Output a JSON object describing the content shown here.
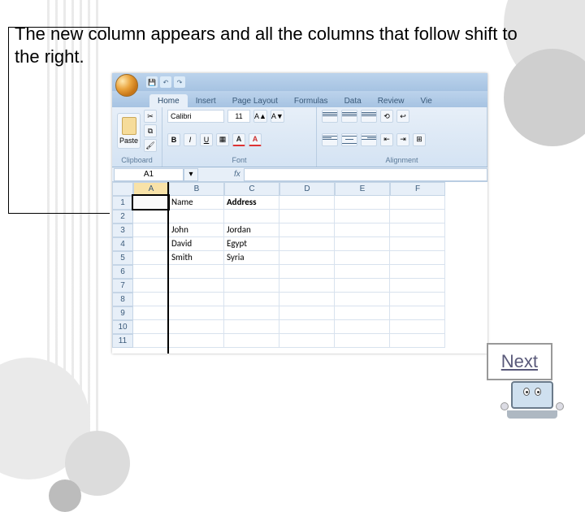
{
  "instruction": "The new column appears and all the columns that follow shift to the right.",
  "next_label": "Next",
  "excel": {
    "tabs": [
      "Home",
      "Insert",
      "Page Layout",
      "Formulas",
      "Data",
      "Review",
      "Vie"
    ],
    "active_tab_index": 0,
    "ribbon_groups": {
      "clipboard": {
        "paste_label": "Paste",
        "group_label": "Clipboard"
      },
      "font": {
        "font_name": "Calibri",
        "font_size": "11",
        "group_label": "Font",
        "bold": "B",
        "italic": "I",
        "underline": "U"
      },
      "alignment": {
        "group_label": "Alignment"
      }
    },
    "name_box": "A1",
    "fx_label": "fx",
    "formula_value": "",
    "columns": [
      "A",
      "B",
      "C",
      "D",
      "E",
      "F"
    ],
    "selected_column": "A",
    "row_numbers": [
      1,
      2,
      3,
      4,
      5,
      6,
      7,
      8,
      9,
      10,
      11
    ],
    "data_rows": [
      {
        "A": "",
        "B": "Name",
        "C": "Address",
        "D": "",
        "E": "",
        "F": ""
      },
      {
        "A": "",
        "B": "",
        "C": "",
        "D": "",
        "E": "",
        "F": ""
      },
      {
        "A": "",
        "B": "John",
        "C": "Jordan",
        "D": "",
        "E": "",
        "F": ""
      },
      {
        "A": "",
        "B": "David",
        "C": "Egypt",
        "D": "",
        "E": "",
        "F": ""
      },
      {
        "A": "",
        "B": "Smith",
        "C": "Syria",
        "D": "",
        "E": "",
        "F": ""
      },
      {
        "A": "",
        "B": "",
        "C": "",
        "D": "",
        "E": "",
        "F": ""
      },
      {
        "A": "",
        "B": "",
        "C": "",
        "D": "",
        "E": "",
        "F": ""
      },
      {
        "A": "",
        "B": "",
        "C": "",
        "D": "",
        "E": "",
        "F": ""
      },
      {
        "A": "",
        "B": "",
        "C": "",
        "D": "",
        "E": "",
        "F": ""
      },
      {
        "A": "",
        "B": "",
        "C": "",
        "D": "",
        "E": "",
        "F": ""
      },
      {
        "A": "",
        "B": "",
        "C": "",
        "D": "",
        "E": "",
        "F": ""
      }
    ],
    "bold_cells": [
      "1-C"
    ]
  }
}
